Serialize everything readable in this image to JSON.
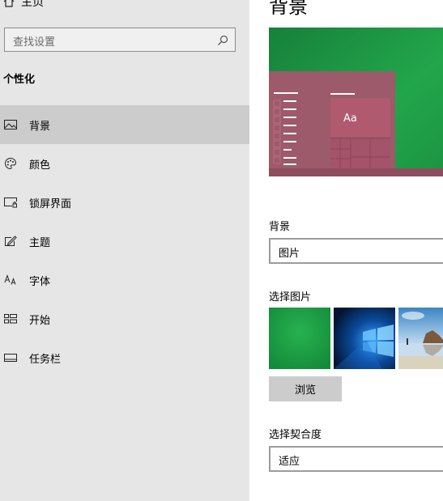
{
  "sidebar": {
    "home_label": "主页",
    "search_placeholder": "查找设置",
    "section_title": "个性化",
    "items": [
      {
        "label": "背景",
        "icon": "picture-icon",
        "active": true
      },
      {
        "label": "颜色",
        "icon": "palette-icon"
      },
      {
        "label": "锁屏界面",
        "icon": "lock-screen-icon"
      },
      {
        "label": "主题",
        "icon": "theme-icon"
      },
      {
        "label": "字体",
        "icon": "font-icon"
      },
      {
        "label": "开始",
        "icon": "start-icon"
      },
      {
        "label": "任务栏",
        "icon": "taskbar-icon"
      }
    ]
  },
  "main": {
    "title": "背景",
    "preview_sample_text": "Aa",
    "background_label": "背景",
    "background_value": "图片",
    "choose_picture_label": "选择图片",
    "browse_label": "浏览",
    "fit_label": "选择契合度",
    "fit_value": "适应"
  },
  "colors": {
    "sidebar_bg": "#e6e6e6",
    "active_item_bg": "#cccccc",
    "accent_green": "#1f9a45",
    "preview_window": "#9c5a6a",
    "preview_tile": "#b05a70"
  }
}
